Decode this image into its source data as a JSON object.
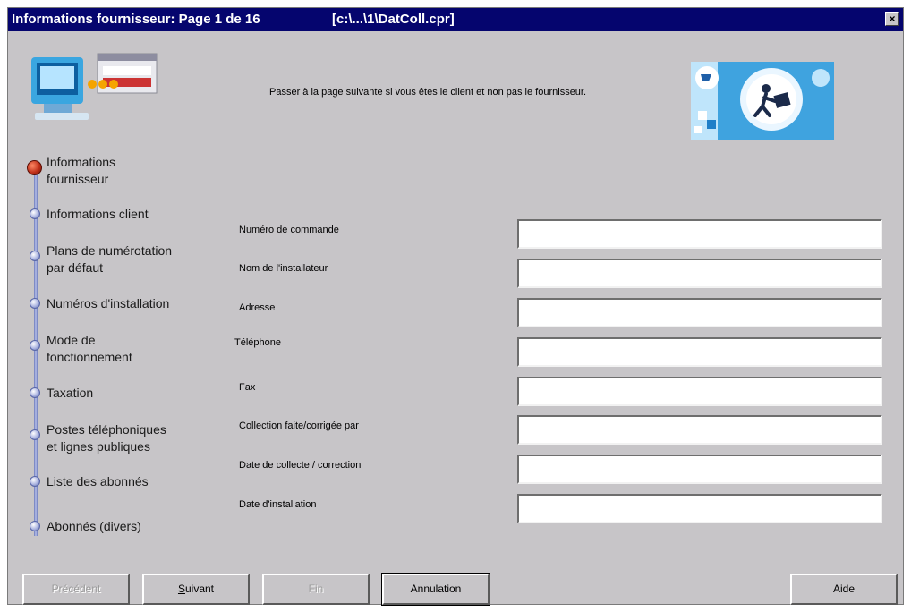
{
  "window": {
    "title": "Informations fournisseur:  Page 1 de 16",
    "path": "[c:\\...\\1\\DatColl.cpr]",
    "close_label": "×"
  },
  "header": {
    "instruction": "Passer à la page suivante si vous êtes le client et non pas le fournisseur."
  },
  "steps": [
    {
      "label": "Informations\nfournisseur",
      "active": true
    },
    {
      "label": "Informations client",
      "active": false
    },
    {
      "label": "Plans de numérotation\npar défaut",
      "active": false
    },
    {
      "label": "Numéros d'installation",
      "active": false
    },
    {
      "label": "Mode de\nfonctionnement",
      "active": false
    },
    {
      "label": "Taxation",
      "active": false
    },
    {
      "label": "Postes téléphoniques\net lignes publiques",
      "active": false
    },
    {
      "label": "Liste des abonnés",
      "active": false
    },
    {
      "label": "Abonnés (divers)",
      "active": false
    }
  ],
  "form": {
    "fields": [
      {
        "label": "Numéro de commande",
        "value": ""
      },
      {
        "label": "Nom de l'installateur",
        "value": ""
      },
      {
        "label": "Adresse",
        "value": ""
      },
      {
        "label": "Téléphone",
        "value": ""
      },
      {
        "label": "Fax",
        "value": ""
      },
      {
        "label": "Collection faite/corrigée par",
        "value": ""
      },
      {
        "label": "Date de collecte / correction",
        "value": ""
      },
      {
        "label": "Date d'installation",
        "value": ""
      }
    ]
  },
  "buttons": {
    "previous": "Précédent",
    "next_underlined": "S",
    "next_rest": "uivant",
    "finish": "Fin",
    "cancel": "Annulation",
    "help": "Aide"
  },
  "colors": {
    "titlebar": "#05056e",
    "window_bg": "#c7c5c8",
    "active_step": "#c0301a",
    "step_track": "#6b79b8"
  },
  "icons": {
    "computer": "computer-illustration-icon",
    "delivery": "delivery-person-icon",
    "close": "close-icon"
  }
}
